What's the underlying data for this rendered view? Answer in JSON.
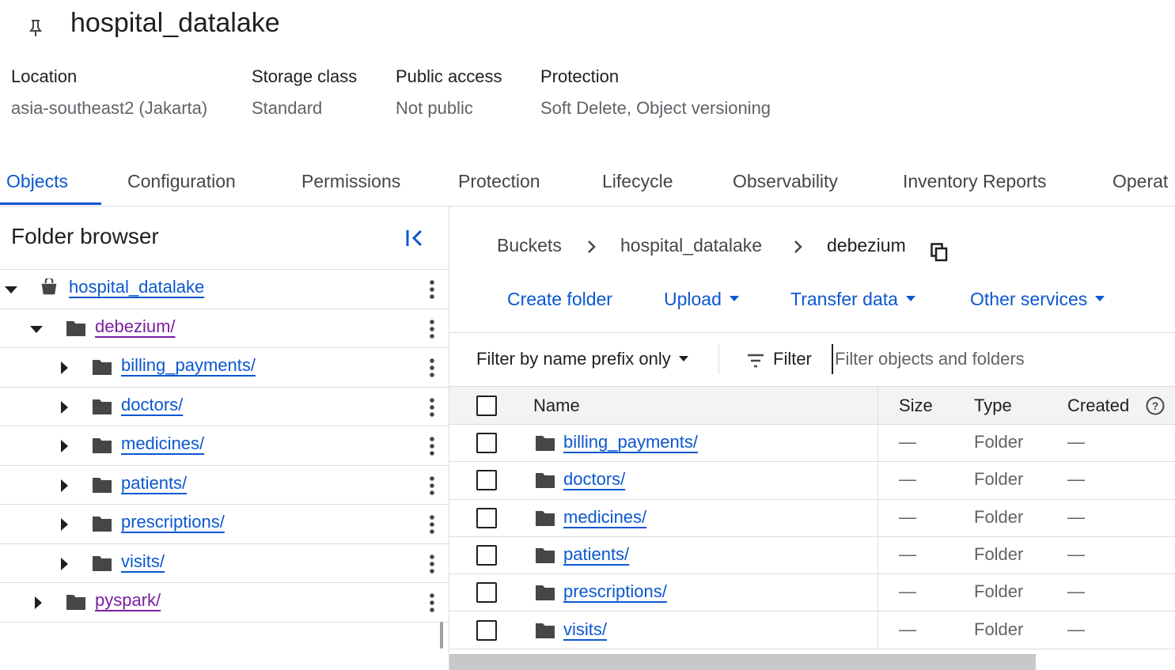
{
  "bucket": {
    "name": "hospital_datalake"
  },
  "meta": [
    {
      "label": "Location",
      "value": "asia-southeast2 (Jakarta)"
    },
    {
      "label": "Storage class",
      "value": "Standard"
    },
    {
      "label": "Public access",
      "value": "Not public"
    },
    {
      "label": "Protection",
      "value": "Soft Delete, Object versioning"
    }
  ],
  "tabs": [
    {
      "label": "Objects",
      "active": true
    },
    {
      "label": "Configuration"
    },
    {
      "label": "Permissions"
    },
    {
      "label": "Protection"
    },
    {
      "label": "Lifecycle"
    },
    {
      "label": "Observability"
    },
    {
      "label": "Inventory Reports"
    },
    {
      "label": "Operat"
    }
  ],
  "folder_browser": {
    "title": "Folder browser",
    "tree": [
      {
        "label": "hospital_datalake",
        "expanded": true
      },
      {
        "label": "debezium/",
        "expanded": true
      },
      {
        "label": "billing_payments/"
      },
      {
        "label": "doctors/"
      },
      {
        "label": "medicines/"
      },
      {
        "label": "patients/"
      },
      {
        "label": "prescriptions/"
      },
      {
        "label": "visits/"
      },
      {
        "label": "pyspark/"
      }
    ]
  },
  "breadcrumb": {
    "items": [
      "Buckets",
      "hospital_datalake",
      "debezium"
    ]
  },
  "actions": {
    "create_folder": "Create folder",
    "upload": "Upload",
    "transfer_data": "Transfer data",
    "other_services": "Other services"
  },
  "filter": {
    "prefix_mode": "Filter by name prefix only",
    "label": "Filter",
    "placeholder": "Filter objects and folders"
  },
  "table": {
    "columns": {
      "name": "Name",
      "size": "Size",
      "type": "Type",
      "created": "Created"
    },
    "rows": [
      {
        "name": "billing_payments/",
        "size": "—",
        "type": "Folder",
        "created": "—"
      },
      {
        "name": "doctors/",
        "size": "—",
        "type": "Folder",
        "created": "—"
      },
      {
        "name": "medicines/",
        "size": "—",
        "type": "Folder",
        "created": "—"
      },
      {
        "name": "patients/",
        "size": "—",
        "type": "Folder",
        "created": "—"
      },
      {
        "name": "prescriptions/",
        "size": "—",
        "type": "Folder",
        "created": "—"
      },
      {
        "name": "visits/",
        "size": "—",
        "type": "Folder",
        "created": "—"
      }
    ]
  },
  "colors": {
    "link": "#0b57d0",
    "visited": "#7b1fa2",
    "icon": "#444746",
    "border": "#dadce0"
  }
}
